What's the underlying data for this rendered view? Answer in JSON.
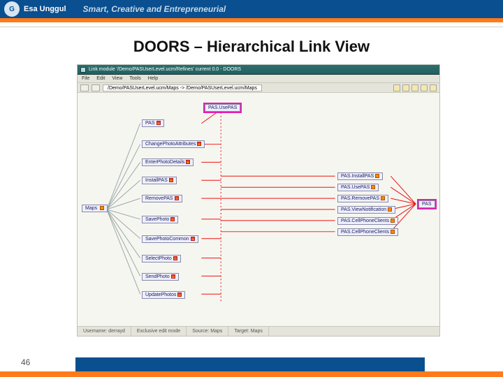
{
  "brand": {
    "name": "Esa Unggul",
    "logo_letter": "G",
    "tagline": "Smart, Creative and Entrepreneurial"
  },
  "slide": {
    "title": "DOORS – Hierarchical Link View",
    "page_number": "46"
  },
  "doors": {
    "window_title": "Link module '/Demo/PASUserLevel.ucm/Refines' current 0.0 - DOORS",
    "menus": [
      "File",
      "Edit",
      "View",
      "Tools",
      "Help"
    ],
    "breadcrumb": "/Demo/PASUserLevel.ucm/Maps -> /Demo/PASUserLevel.ucm/Maps",
    "status": {
      "user": "Username: derrayd",
      "mode": "Exclusive edit mode",
      "source": "Source: Maps",
      "target": "Target: Maps"
    },
    "left_root": "Maps",
    "col_mid": [
      "PAS",
      "ChangePhotoAttributes",
      "EnterPhotoDetails",
      "InstallPAS",
      "RemovePAS",
      "SavePhoto",
      "SavePhotoCommon",
      "SelectPhoto",
      "SendPhoto",
      "UpdatePhotos"
    ],
    "top_center": "PAS.UsePAS",
    "col_right": [
      "PAS.InstallPAS",
      "PAS.UsePAS",
      "PAS.RemovePAS",
      "PAS.ViewNotification",
      "PAS.CellPhoneClients",
      "PAS.CellPhoneClients"
    ],
    "far_right": "PAS"
  }
}
